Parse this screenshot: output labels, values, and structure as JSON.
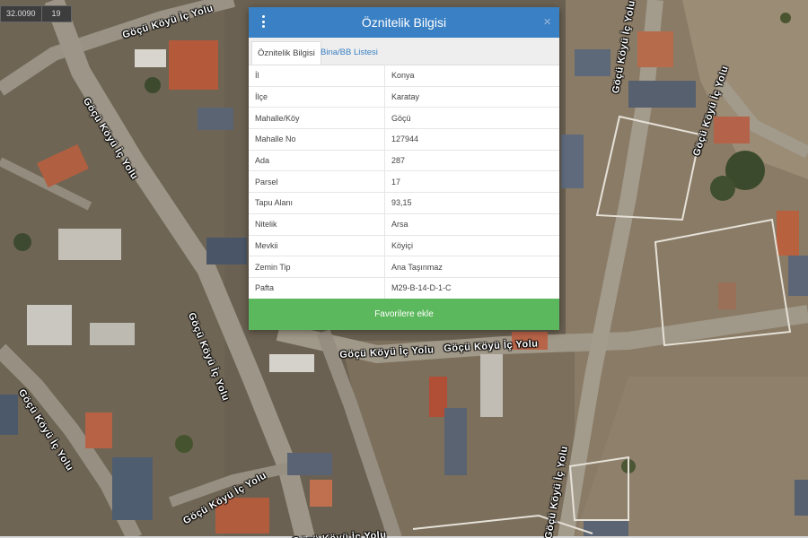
{
  "map": {
    "coordinates": [
      "32.0090",
      "19"
    ],
    "street_labels": [
      "Göçü Köyü İç Yolu",
      "Göçü Köyü İç Yolu",
      "Göçü Köyü İç Yolu",
      "Göçü Köyü İç Yolu",
      "Göçü Köyü İç Yolu",
      "Göçü Köyü İç Yolu",
      "Göçü Köyü İç Yolu",
      "Göçü Köyü İç Yolu",
      "Göçü Köyü İç Yolu",
      "Göçü Köyü İç Yolu",
      "Göçü Köyü İç Yolu"
    ]
  },
  "dialog": {
    "title": "Öznitelik Bilgisi",
    "close": "×",
    "tabs": [
      "Öznitelik Bilgisi",
      "Bina/BB Listesi"
    ],
    "rows": [
      {
        "key": "İl",
        "value": "Konya"
      },
      {
        "key": "İlçe",
        "value": "Karatay"
      },
      {
        "key": "Mahalle/Köy",
        "value": "Göçü"
      },
      {
        "key": "Mahalle No",
        "value": "127944"
      },
      {
        "key": "Ada",
        "value": "287"
      },
      {
        "key": "Parsel",
        "value": "17"
      },
      {
        "key": "Tapu Alanı",
        "value": "93,15"
      },
      {
        "key": "Nitelik",
        "value": "Arsa"
      },
      {
        "key": "Mevkii",
        "value": "Köyiçi"
      },
      {
        "key": "Zemin Tip",
        "value": "Ana Taşınmaz"
      },
      {
        "key": "Pafta",
        "value": "M29-B-14-D-1-C"
      }
    ],
    "favorite_button": "Favorilere ekle"
  },
  "colors": {
    "header": "#3a80c4",
    "button": "#5cb85c"
  }
}
